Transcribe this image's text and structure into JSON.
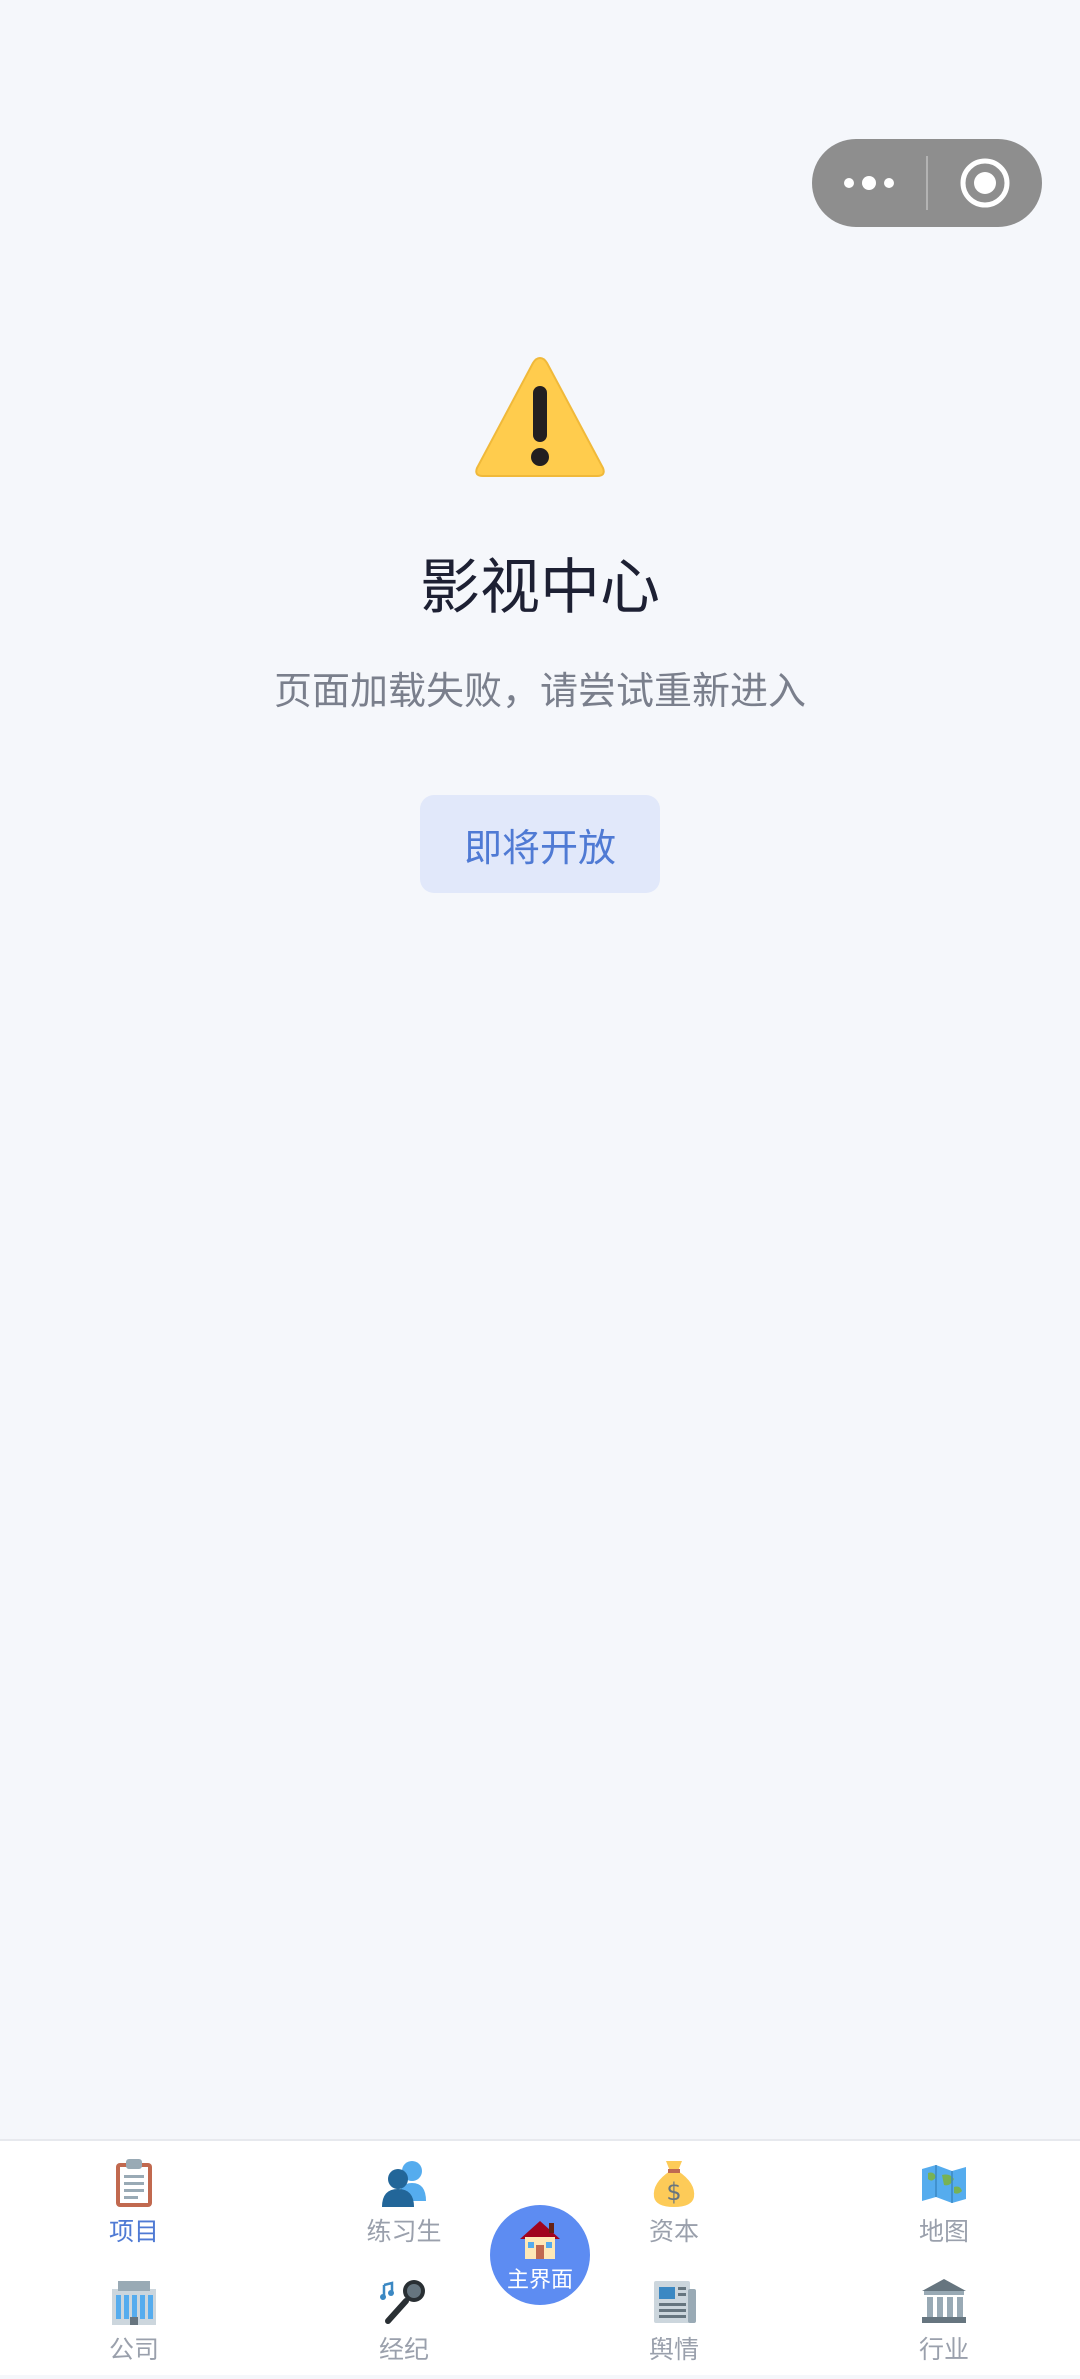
{
  "capsule": {
    "more_icon": "ellipsis-icon",
    "close_icon": "target-circle-icon"
  },
  "main": {
    "icon": "warning-triangle-icon",
    "title": "影视中心",
    "subtitle": "页面加载失败，请尝试重新进入",
    "button_label": "即将开放"
  },
  "tabbar": {
    "active_color": "#4f7ad4",
    "home_label": "主界面",
    "tabs": [
      {
        "label": "项目",
        "icon": "clipboard-icon",
        "active": true
      },
      {
        "label": "练习生",
        "icon": "people-icon",
        "active": false
      },
      {
        "label": "资本",
        "icon": "money-bag-icon",
        "active": false
      },
      {
        "label": "地图",
        "icon": "world-map-icon",
        "active": false
      },
      {
        "label": "公司",
        "icon": "office-building-icon",
        "active": false
      },
      {
        "label": "经纪",
        "icon": "microphone-icon",
        "active": false
      },
      {
        "label": "舆情",
        "icon": "newspaper-icon",
        "active": false
      },
      {
        "label": "行业",
        "icon": "classical-building-icon",
        "active": false
      }
    ]
  }
}
